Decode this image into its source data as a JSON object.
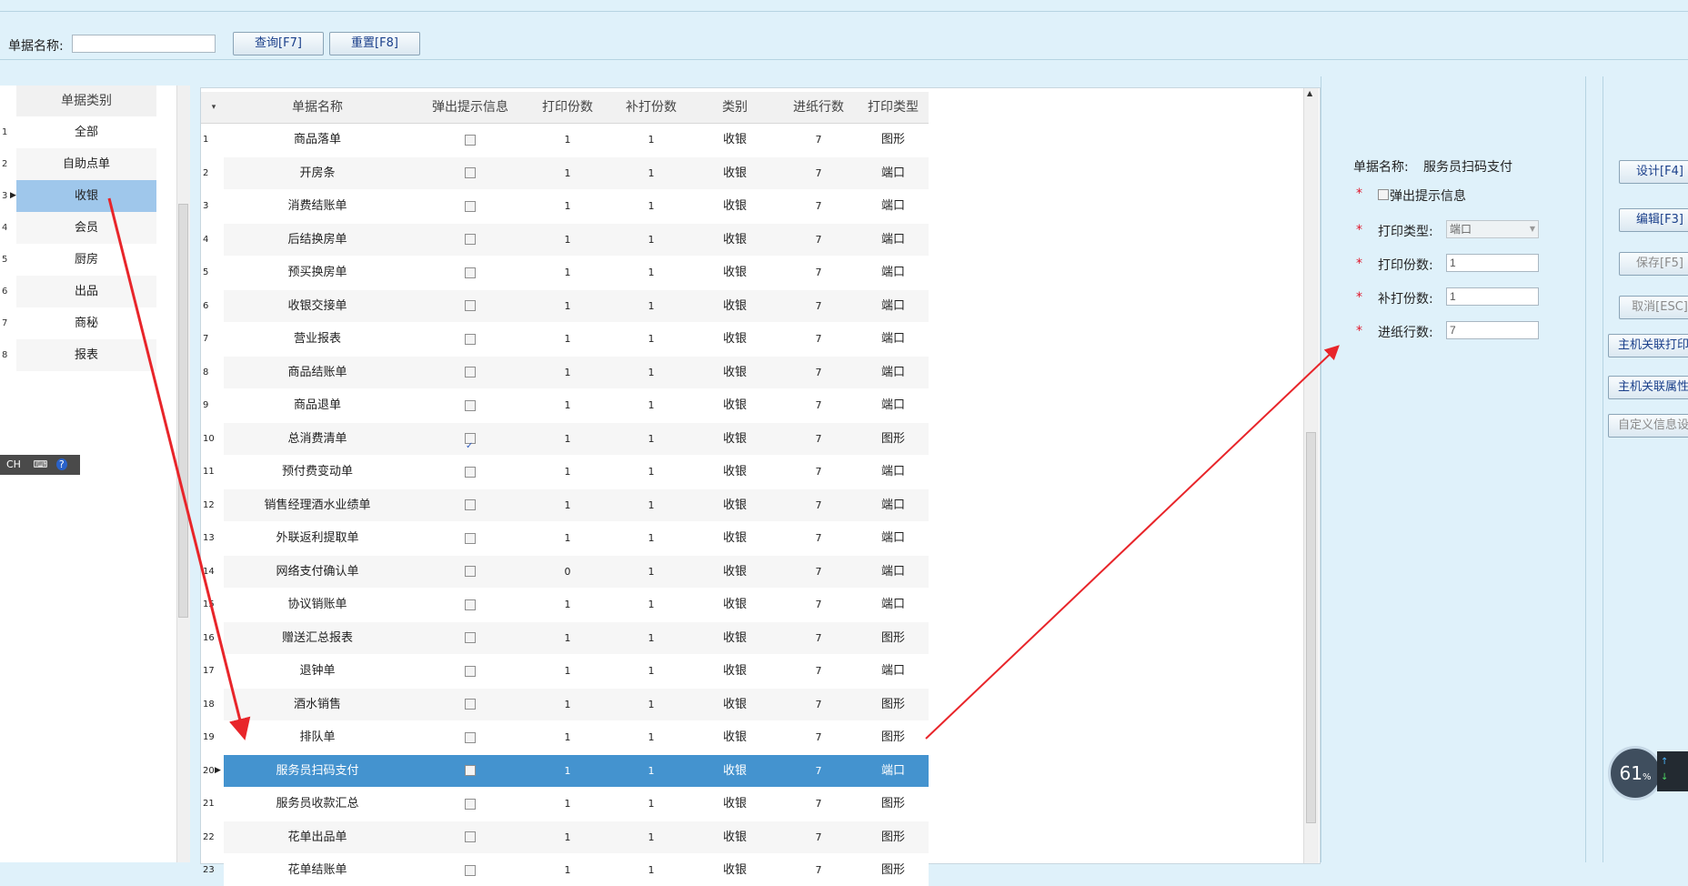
{
  "search": {
    "label": "单据名称:",
    "value": "",
    "query_button": "查询[F7]",
    "reset_button": "重置[F8]"
  },
  "categories": {
    "header": "单据类别",
    "items": [
      {
        "num": "1",
        "label": "全部"
      },
      {
        "num": "2",
        "label": "自助点单"
      },
      {
        "num": "3",
        "label": "收银"
      },
      {
        "num": "4",
        "label": "会员"
      },
      {
        "num": "5",
        "label": "厨房"
      },
      {
        "num": "6",
        "label": "出品"
      },
      {
        "num": "7",
        "label": "商秘"
      },
      {
        "num": "8",
        "label": "报表"
      }
    ],
    "selected_index": 2
  },
  "ime": {
    "label": "CH"
  },
  "grid": {
    "columns": [
      "单据名称",
      "弹出提示信息",
      "打印份数",
      "补打份数",
      "类别",
      "进纸行数",
      "打印类型"
    ],
    "rows": [
      {
        "num": "1",
        "name": "商品落单",
        "popup": false,
        "copies": "1",
        "reprint": "1",
        "category": "收银",
        "feed": "7",
        "type": "图形"
      },
      {
        "num": "2",
        "name": "开房条",
        "popup": false,
        "copies": "1",
        "reprint": "1",
        "category": "收银",
        "feed": "7",
        "type": "端口"
      },
      {
        "num": "3",
        "name": "消费结账单",
        "popup": false,
        "copies": "1",
        "reprint": "1",
        "category": "收银",
        "feed": "7",
        "type": "端口"
      },
      {
        "num": "4",
        "name": "后结换房单",
        "popup": false,
        "copies": "1",
        "reprint": "1",
        "category": "收银",
        "feed": "7",
        "type": "端口"
      },
      {
        "num": "5",
        "name": "预买换房单",
        "popup": false,
        "copies": "1",
        "reprint": "1",
        "category": "收银",
        "feed": "7",
        "type": "端口"
      },
      {
        "num": "6",
        "name": "收银交接单",
        "popup": false,
        "copies": "1",
        "reprint": "1",
        "category": "收银",
        "feed": "7",
        "type": "端口"
      },
      {
        "num": "7",
        "name": "营业报表",
        "popup": false,
        "copies": "1",
        "reprint": "1",
        "category": "收银",
        "feed": "7",
        "type": "端口"
      },
      {
        "num": "8",
        "name": "商品结账单",
        "popup": false,
        "copies": "1",
        "reprint": "1",
        "category": "收银",
        "feed": "7",
        "type": "端口"
      },
      {
        "num": "9",
        "name": "商品退单",
        "popup": false,
        "copies": "1",
        "reprint": "1",
        "category": "收银",
        "feed": "7",
        "type": "端口"
      },
      {
        "num": "10",
        "name": "总消费清单",
        "popup": true,
        "copies": "1",
        "reprint": "1",
        "category": "收银",
        "feed": "7",
        "type": "图形"
      },
      {
        "num": "11",
        "name": "预付费变动单",
        "popup": false,
        "copies": "1",
        "reprint": "1",
        "category": "收银",
        "feed": "7",
        "type": "端口"
      },
      {
        "num": "12",
        "name": "销售经理酒水业绩单",
        "popup": false,
        "copies": "1",
        "reprint": "1",
        "category": "收银",
        "feed": "7",
        "type": "端口"
      },
      {
        "num": "13",
        "name": "外联返利提取单",
        "popup": false,
        "copies": "1",
        "reprint": "1",
        "category": "收银",
        "feed": "7",
        "type": "端口"
      },
      {
        "num": "14",
        "name": "网络支付确认单",
        "popup": false,
        "copies": "0",
        "reprint": "1",
        "category": "收银",
        "feed": "7",
        "type": "端口"
      },
      {
        "num": "15",
        "name": "协议销账单",
        "popup": false,
        "copies": "1",
        "reprint": "1",
        "category": "收银",
        "feed": "7",
        "type": "端口"
      },
      {
        "num": "16",
        "name": "赠送汇总报表",
        "popup": false,
        "copies": "1",
        "reprint": "1",
        "category": "收银",
        "feed": "7",
        "type": "图形"
      },
      {
        "num": "17",
        "name": "退钟单",
        "popup": false,
        "copies": "1",
        "reprint": "1",
        "category": "收银",
        "feed": "7",
        "type": "端口"
      },
      {
        "num": "18",
        "name": "酒水销售",
        "popup": false,
        "copies": "1",
        "reprint": "1",
        "category": "收银",
        "feed": "7",
        "type": "图形"
      },
      {
        "num": "19",
        "name": "排队单",
        "popup": false,
        "copies": "1",
        "reprint": "1",
        "category": "收银",
        "feed": "7",
        "type": "图形"
      },
      {
        "num": "20",
        "name": "服务员扫码支付",
        "popup": false,
        "copies": "1",
        "reprint": "1",
        "category": "收银",
        "feed": "7",
        "type": "端口"
      },
      {
        "num": "21",
        "name": "服务员收款汇总",
        "popup": false,
        "copies": "1",
        "reprint": "1",
        "category": "收银",
        "feed": "7",
        "type": "图形"
      },
      {
        "num": "22",
        "name": "花单出品单",
        "popup": false,
        "copies": "1",
        "reprint": "1",
        "category": "收银",
        "feed": "7",
        "type": "图形"
      },
      {
        "num": "23",
        "name": "花单结账单",
        "popup": false,
        "copies": "1",
        "reprint": "1",
        "category": "收银",
        "feed": "7",
        "type": "图形"
      }
    ],
    "selected_index": 19
  },
  "detail": {
    "name_label": "单据名称:",
    "name_value": "服务员扫码支付",
    "popup_label": "弹出提示信息",
    "print_type_label": "打印类型:",
    "print_type_value": "端口",
    "copies_label": "打印份数:",
    "copies_value": "1",
    "reprint_label": "补打份数:",
    "reprint_value": "1",
    "feed_label": "进纸行数:",
    "feed_value": "7",
    "required_mark": "*"
  },
  "actions": {
    "design": "设计[F4]",
    "edit": "编辑[F3]",
    "save": "保存[F5]",
    "cancel": "取消[ESC]",
    "host_print": "主机关联打印",
    "host_attr": "主机关联属性",
    "custom_info": "自定义信息设"
  },
  "monitor": {
    "percent": "61",
    "unit": "%"
  },
  "colors": {
    "background": "#dff1fa",
    "selected_row": "#4493cf",
    "selected_category": "#9fc7eb",
    "annotation_arrow": "#e8252a",
    "required": "#e0162b"
  }
}
